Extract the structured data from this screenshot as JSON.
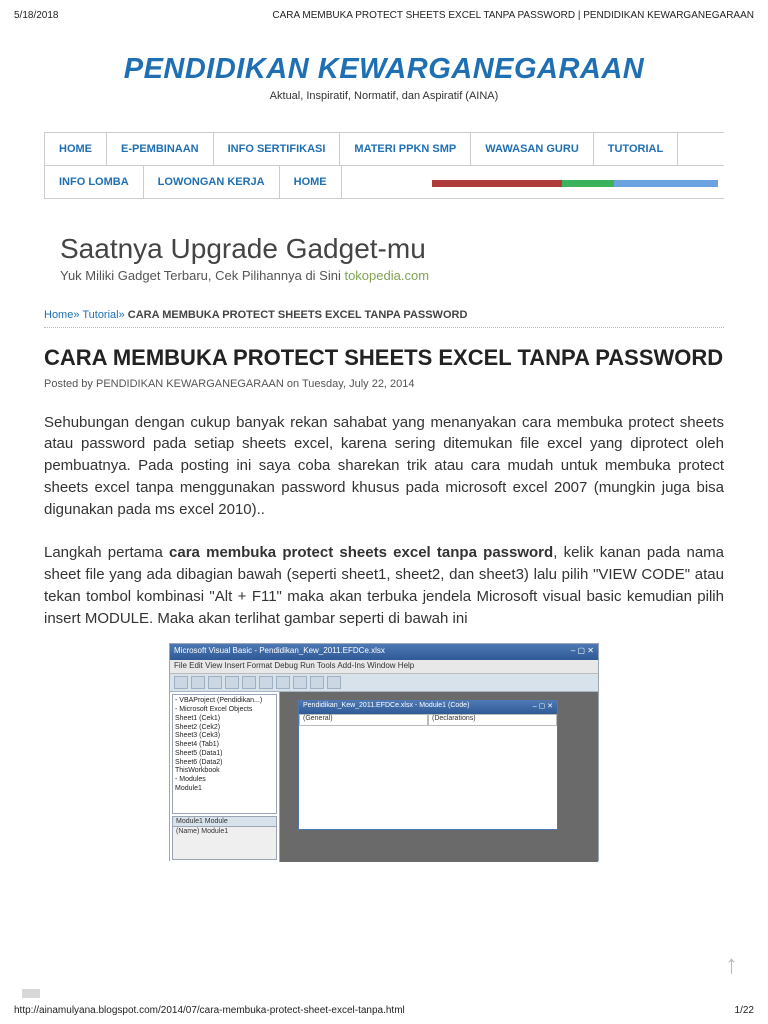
{
  "print": {
    "date": "5/18/2018",
    "header_title": "CARA MEMBUKA PROTECT SHEETS EXCEL TANPA PASSWORD | PENDIDIKAN KEWARGANEGARAAN",
    "footer_url": "http://ainamulyana.blogspot.com/2014/07/cara-membuka-protect-sheet-excel-tanpa.html",
    "page_num": "1/22"
  },
  "site": {
    "title": "PENDIDIKAN KEWARGANEGARAAN",
    "tagline": "Aktual, Inspiratif, Normatif, dan Aspiratif (AINA)"
  },
  "nav": {
    "row1": [
      "HOME",
      "E-PEMBINAAN",
      "INFO SERTIFIKASI",
      "MATERI PPKN SMP",
      "WAWASAN GURU",
      "TUTORIAL"
    ],
    "row2": [
      "INFO LOMBA",
      "LOWONGAN KERJA",
      "HOME"
    ]
  },
  "strip_colors": [
    "#b03b3b",
    "#b03b3b",
    "#b03b3b",
    "#b03b3b",
    "#b03b3b",
    "#3bb35d",
    "#3bb35d",
    "#6aa3e0",
    "#6aa3e0",
    "#6aa3e0",
    "#6aa3e0"
  ],
  "ad": {
    "title": "Saatnya Upgrade Gadget-mu",
    "sub_prefix": "Yuk Miliki Gadget Terbaru, Cek Pilihannya di Sini ",
    "sub_link": "tokopedia.com"
  },
  "breadcrumb": {
    "home": "Home",
    "sep1": "» ",
    "cat": "Tutorial",
    "sep2": "» ",
    "current": "CARA MEMBUKA PROTECT SHEETS EXCEL TANPA PASSWORD"
  },
  "post": {
    "title": "CARA MEMBUKA PROTECT SHEETS EXCEL TANPA PASSWORD",
    "by_prefix": "Posted by ",
    "by_author": "PENDIDIKAN KEWARGANEGARAAN",
    "by_mid": " on ",
    "by_date": "Tuesday, July 22, 2014",
    "para1": "Sehubungan dengan cukup banyak rekan sahabat yang menanyakan cara membuka protect sheets atau password pada setiap sheets excel, karena sering ditemukan file excel yang diprotect oleh pembuatnya. Pada posting ini saya coba sharekan trik atau cara mudah untuk membuka protect sheets excel tanpa menggunakan password khusus pada microsoft excel 2007 (mungkin juga bisa digunakan pada ms excel 2010)..",
    "para2_pre": "Langkah pertama ",
    "para2_bold": "cara membuka protect sheets excel tanpa password",
    "para2_post": ", kelik kanan pada nama sheet file yang ada dibagian bawah (seperti sheet1, sheet2, dan sheet3) lalu pilih \"VIEW CODE\" atau tekan tombol kombinasi \"Alt + F11\" maka akan terbuka jendela Microsoft visual basic kemudian pilih insert MODULE. Maka akan terlihat gambar seperti di bawah ini"
  },
  "vb": {
    "app_title": "Microsoft Visual Basic - Pendidikan_Kew_2011.EFDCe.xlsx",
    "menu": "File   Edit   View   Insert   Format   Debug   Run   Tools   Add-Ins   Window   Help",
    "tree": [
      "- VBAProject (Pendidikan...)",
      "  - Microsoft Excel Objects",
      "    Sheet1 (Cek1)",
      "    Sheet2 (Cek2)",
      "    Sheet3 (Cek3)",
      "    Sheet4 (Tab1)",
      "    Sheet5 (Data1)",
      "    Sheet6 (Data2)",
      "    ThisWorkbook",
      "  - Modules",
      "    Module1"
    ],
    "prop_header": "Module1  Module",
    "prop_row": "(Name)   Module1",
    "code_title": "Pendidikan_Kew_2011.EFDCe.xlsx - Module1 (Code)",
    "drop_left": "(General)",
    "drop_right": "(Declarations)"
  },
  "scroll_top": "↑"
}
